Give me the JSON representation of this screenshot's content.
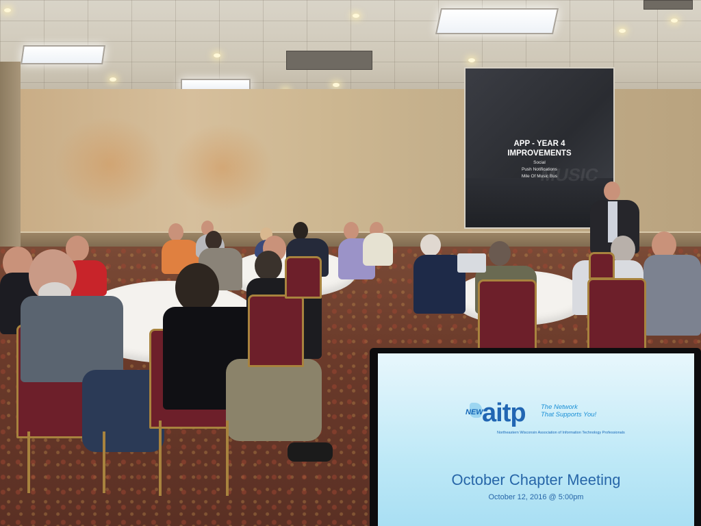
{
  "projection": {
    "title_line1": "APP - YEAR 4",
    "title_line2": "IMPROVEMENTS",
    "items": [
      "Social",
      "Push Notifications",
      "Mile Of Music Bus"
    ],
    "background_word": "MUSIC"
  },
  "laptop": {
    "logo_prefix": "NEW",
    "logo_name": "aitp",
    "tagline_line1": "The Network",
    "tagline_line2": "That Supports You!",
    "association": "Northeastern Wisconsin Association of Information Technology Professionals",
    "meeting_title": "October Chapter Meeting",
    "meeting_date": "October 12, 2016 @ 5:00pm"
  },
  "colors": {
    "screen_text": "#2766a8",
    "chair_fabric": "#6d1f2a",
    "chair_frame": "#a8833e"
  }
}
